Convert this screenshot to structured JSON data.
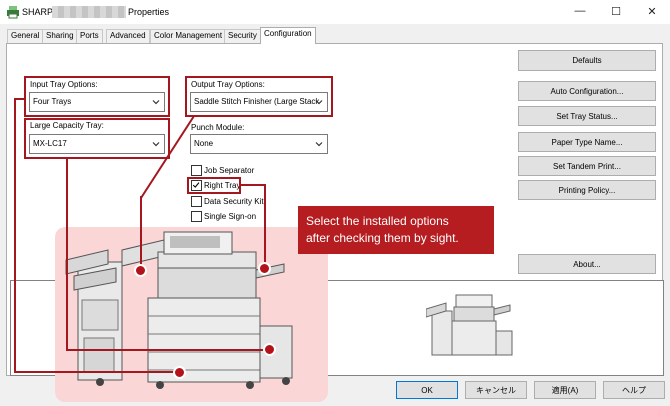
{
  "window": {
    "app_name": "SHARP",
    "title_suffix": "Properties",
    "controls": {
      "minimize": "—",
      "maximize": "☐",
      "close": "✕"
    }
  },
  "tabs": [
    "General",
    "Sharing",
    "Ports",
    "Advanced",
    "Color Management",
    "Security",
    "Configuration"
  ],
  "active_tab": "Configuration",
  "input_tray": {
    "label": "Input Tray Options:",
    "value": "Four Trays"
  },
  "large_capacity": {
    "label": "Large Capacity Tray:",
    "value": "MX-LC17"
  },
  "output_tray": {
    "label": "Output Tray Options:",
    "value": "Saddle Stitch Finisher (Large Stack"
  },
  "punch": {
    "label": "Punch Module:",
    "value": "None"
  },
  "checkboxes": [
    {
      "label": "Job Separator",
      "checked": false
    },
    {
      "label": "Right Tray",
      "checked": true
    },
    {
      "label": "Data Security Kit",
      "checked": false
    },
    {
      "label": "Single Sign-on",
      "checked": false
    }
  ],
  "right_buttons": {
    "defaults": "Defaults",
    "auto_config": "Auto Configuration...",
    "tray_status": "Set Tray Status...",
    "paper_type": "Paper Type Name...",
    "tandem": "Set Tandem Print...",
    "printing_policy": "Printing Policy...",
    "about": "About..."
  },
  "callout": {
    "line1": "Select the installed options",
    "line2": "after checking them by sight."
  },
  "bottom_buttons": {
    "ok": "OK",
    "cancel": "キャンセル",
    "apply": "適用(A)",
    "help": "ヘルプ"
  },
  "colors": {
    "highlight": "#a4171f",
    "callout_bg": "#b51d21",
    "pink_bg": "#fbd6d7",
    "accent": "#0078d7"
  }
}
